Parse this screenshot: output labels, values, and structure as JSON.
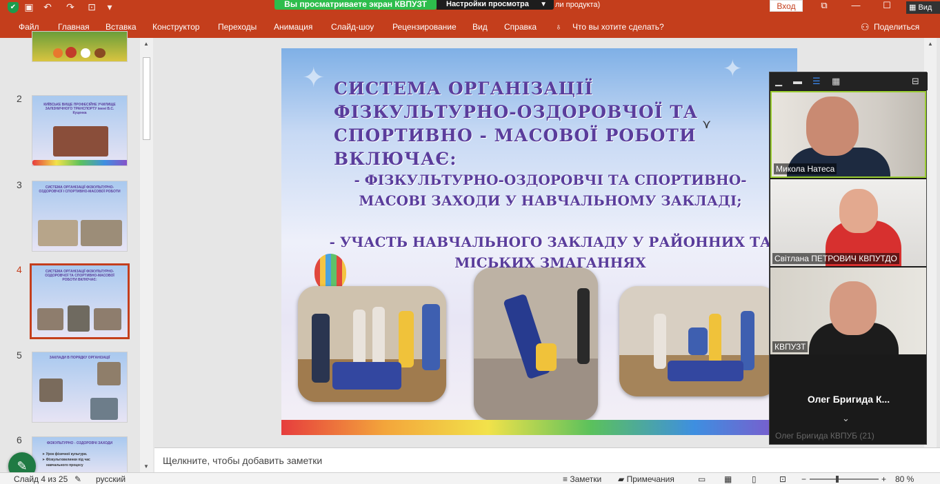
{
  "meeting": {
    "share_banner": "Вы просматриваете экран КВПУЗТ",
    "view_settings_label": "Настройки просмотра",
    "view_button_label": "Вид"
  },
  "titlebar": {
    "doc_title_partial": "ли продукта)",
    "signin_label": "Вход"
  },
  "ribbon": {
    "tabs": [
      "Файл",
      "Главная",
      "Вставка",
      "Конструктор",
      "Переходы",
      "Анимация",
      "Слайд-шоу",
      "Рецензирование",
      "Вид",
      "Справка"
    ],
    "tell_me": "Что вы хотите сделать?",
    "share": "Поделиться"
  },
  "thumbnails": {
    "slides": [
      {
        "num": "2",
        "text": "КИЇВСЬКЕ ВИЩЕ ПРОФЕСІЙНЕ УЧИЛИЩЕ ЗАЛІЗНИЧНОГО ТРАНСПОРТУ імені В.С. Куценка"
      },
      {
        "num": "3",
        "text": "СИСТЕМА ОРГАНІЗАЦІЇ ФІЗКУЛЬТУРНО-ОЗДОРОВЧОЇ І СПОРТИВНО-МАСОВОЇ РОБОТИ"
      },
      {
        "num": "4",
        "text": "СИСТЕМА ОРГАНІЗАЦІЇ ФІЗКУЛЬТУРНО-ОЗДОРОВЧОЇ ТА СПОРТИВНО-МАСОВОЇ РОБОТИ ВКЛЮЧАЄ:"
      },
      {
        "num": "5",
        "text": "ЗАКЛАДИ В ПОРЯДКУ ОРГАНІЗАЦІЇ"
      },
      {
        "num": "6",
        "text": "ФІЗКУЛЬТУРНО - ОЗДОРОВЧІ ЗАХОДИ"
      }
    ],
    "slide6_lines": [
      "➤ Урок фізичної культури.",
      "➤ Фізкультхвилинки під час",
      "навчального процесу"
    ]
  },
  "slide": {
    "heading": "СИСТЕМА ОРГАНІЗАЦІЇ ФІЗКУЛЬТУРНО-ОЗДОРОВЧОЇ ТА СПОРТИВНО - МАСОВОЇ РОБОТИ ВКЛЮЧАЄ:",
    "bullet1": "- ФІЗКУЛЬТУРНО-ОЗДОРОВЧІ ТА СПОРТИВНО-МАСОВІ ЗАХОДИ У НАВЧАЛЬНОМУ ЗАКЛАДІ;",
    "bullet2": "- УЧАСТЬ НАВЧАЛЬНОГО ЗАКЛАДУ У РАЙОННИХ ТА МІСЬКИХ ЗМАГАННЯХ"
  },
  "participants": [
    {
      "name": "Микола Натеса",
      "active": true
    },
    {
      "name": "Світлана ПЕТРОВИЧ КВПУТДО",
      "active": false
    },
    {
      "name": "КВПУЗТ",
      "active": false
    }
  ],
  "zoom_panel": {
    "big_name": "Олег Бригида К...",
    "tail_text": "Олег Бригида КВПУБ (21)"
  },
  "notes": {
    "placeholder": "Щелкните, чтобы добавить заметки"
  },
  "statusbar": {
    "slide_info": "Слайд 4 из 25",
    "language": "русский",
    "notes_label": "Заметки",
    "comments_label": "Примечания",
    "zoom_minus": "−",
    "zoom_plus": "+",
    "zoom": "80 %",
    "zoom_fraction": 0.4
  },
  "colors": {
    "accent": "#c43e1c",
    "share_green": "#2dbd4c",
    "slide_text": "#5a3d9c",
    "active_speaker": "#9acd32"
  },
  "icons": {
    "security": "shield-icon",
    "save": "save-icon",
    "undo": "undo-icon",
    "redo": "redo-icon",
    "presenter": "present-icon",
    "customize": "chevron-down-icon",
    "help_bulb": "lightbulb-icon",
    "share": "person-icon",
    "annotate": "pen-icon"
  }
}
